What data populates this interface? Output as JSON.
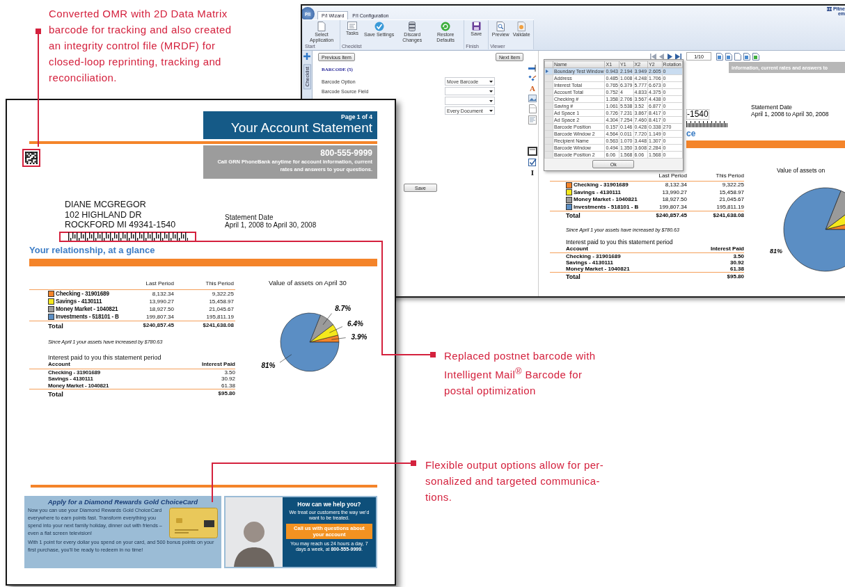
{
  "callouts": [
    {
      "lines": [
        "Converted OMR with 2D Data Matrix",
        "barcode for tracking  and also created",
        "an integrity control file (MRDF) for",
        "closed-loop reprinting, tracking and",
        "reconciliation."
      ]
    },
    {
      "lines": [
        "Replaced postnet barcode with",
        "Intelligent Mail$^{®}$ Barcode for",
        "postal optimization"
      ]
    },
    {
      "lines": [
        "Flexible output options allow for per-",
        "sonalized and targeted communica-",
        "tions."
      ]
    }
  ],
  "app_window": {
    "logo": "P/I",
    "brand": [
      "Pitne",
      "em"
    ],
    "tabs": [
      {
        "label": "P/I Wizard",
        "selected": true
      },
      {
        "label": "P/I Configuration",
        "selected": false
      }
    ],
    "ribbon": [
      {
        "group": "Start",
        "buttons": [
          {
            "label": "Select Application",
            "kind": "page"
          }
        ]
      },
      {
        "group": "Checklist",
        "buttons": [
          {
            "label": "Tasks",
            "kind": "tasks"
          },
          {
            "label": "Save Settings",
            "kind": "check"
          },
          {
            "label": "Discard Changes",
            "kind": "discard"
          },
          {
            "label": "Restore Defaults",
            "kind": "restore"
          }
        ]
      },
      {
        "group": "Finish",
        "buttons": [
          {
            "label": "Save",
            "kind": "save"
          }
        ]
      },
      {
        "group": "Viewer",
        "buttons": [
          {
            "label": "Preview",
            "kind": "preview"
          },
          {
            "label": "Validate",
            "kind": "validate"
          }
        ]
      }
    ],
    "side_tab": "Checklist",
    "prev_button": "Previous Item",
    "next_button": "Next Item",
    "section": "BARCODE (5)",
    "form_rows": [
      {
        "label": "Barcode Option",
        "value": "Move Barcode"
      },
      {
        "label": "Barcode Source Field"
      },
      {},
      {
        "value": "Every Document"
      }
    ],
    "save_button": "Save",
    "tools": [
      {
        "kind": "line"
      },
      {
        "kind": "shapes"
      },
      {
        "kind": "text",
        "glyph": "A"
      },
      {
        "kind": "image"
      },
      {
        "kind": "page"
      },
      {
        "kind": "layout"
      },
      {
        "kind": "frame"
      },
      {
        "kind": "check"
      },
      {
        "kind": "text",
        "glyph": "I"
      }
    ],
    "pager": "1/10",
    "grid": {
      "columns": [
        "Name",
        "X1",
        "Y1",
        "X2",
        "Y2",
        "Rotation"
      ],
      "rows": [
        {
          "cells": [
            "Boundary Test Window",
            "0.943",
            "2.194",
            "3.949",
            "2.605",
            "0"
          ],
          "selected": true
        },
        {
          "cells": [
            "Address",
            "0.485",
            "1.008",
            "4.248",
            "1.706",
            "0"
          ],
          "selected": false
        },
        {
          "cells": [
            "Interest Total",
            "0.765",
            "6.379",
            "5.777",
            "6.673",
            "0"
          ],
          "selected": false
        },
        {
          "cells": [
            "Account Total",
            "0.752",
            "4",
            "4.833",
            "4.375",
            "0"
          ],
          "selected": false
        },
        {
          "cells": [
            "Checking #",
            "1.358",
            "2.706",
            "3.567",
            "4.438",
            "0"
          ],
          "selected": false
        },
        {
          "cells": [
            "Saving #",
            "1.061",
            "5.538",
            "3.52",
            "6.877",
            "0"
          ],
          "selected": false
        },
        {
          "cells": [
            "Ad Space 1",
            "0.726",
            "7.231",
            "3.867",
            "8.417",
            "0"
          ],
          "selected": false
        },
        {
          "cells": [
            "Ad Space 2",
            "4.304",
            "7.254",
            "7.460",
            "8.417",
            "0"
          ],
          "selected": false
        },
        {
          "cells": [
            "Barcode Position",
            "0.157",
            "0.146",
            "0.428",
            "0.338",
            "270"
          ],
          "selected": false
        },
        {
          "cells": [
            "Barcode Window 2",
            "4.564",
            "0.011",
            "7.720",
            "1.149",
            "0"
          ],
          "selected": false
        },
        {
          "cells": [
            "Recipient Name",
            "0.563",
            "1.070",
            "3.448",
            "1.307",
            "0"
          ],
          "selected": false
        },
        {
          "cells": [
            "Barcode Window",
            "0.494",
            "1.350",
            "3.608",
            "2.284",
            "0"
          ],
          "selected": false
        },
        {
          "cells": [
            "Barcode Position 2",
            "6.06",
            "1.568",
            "6.06",
            "1.568",
            "0"
          ],
          "selected": false
        }
      ],
      "ok_button": "Ok"
    },
    "preview": {
      "banner": "information, current rates and answers to",
      "address_tail": "-1540",
      "date_label": "Statement Date",
      "date_range": "April 1, 2008 to April 30, 2008",
      "heading_tail": "ce",
      "columns": [
        "Last Period",
        "This Period"
      ],
      "chart_title": "Value of assets on",
      "accounts": [
        {
          "name": "Checking - 31901689",
          "last": "8,132.34",
          "this": "9,322.25",
          "color": "#f4842a"
        },
        {
          "name": "Savings - 4130111",
          "last": "13,990.27",
          "this": "15,458.97",
          "color": "#f5e81c"
        },
        {
          "name": "Money Market - 1040821",
          "last": "18,927.50",
          "this": "21,045.67",
          "color": "#9a9a9a"
        },
        {
          "name": "Investments - 518101 - B",
          "last": "199,807.34",
          "this": "195,811.19",
          "color": "#5b8ec4"
        }
      ],
      "total": {
        "label": "Total",
        "last": "$240,857.45",
        "this": "$241,638.08"
      },
      "note": "Since April 1 your assets have increased by $780.63",
      "interest_title": "Interest paid to you this statement period",
      "interest_columns": [
        "Account",
        "Interest Paid"
      ],
      "interest_rows": [
        {
          "name": "Checking - 31901689",
          "value": "3.50"
        },
        {
          "name": "Savings - 4130111",
          "value": "30.92"
        },
        {
          "name": "Money Market - 1040821",
          "value": "61.38"
        }
      ],
      "interest_total": {
        "label": "Total",
        "value": "$95.80"
      },
      "pie_label": "81%"
    }
  },
  "statement": {
    "page": "Page 1 of 4",
    "title": "Your Account Statement",
    "phone": "800-555-9999",
    "phone_note": "Call GRN PhoneBank anytime for account information, current rates and answers to your questions.",
    "address": [
      "DIANE MCGREGOR",
      "102 HIGHLAND DR",
      "ROCKFORD MI 49341-1540"
    ],
    "date_label": "Statement Date",
    "date_range": "April 1, 2008 to April 30, 2008",
    "heading": "Your relationship, at a glance",
    "columns": [
      "Last Period",
      "This Period"
    ],
    "accounts": [
      {
        "name": "Checking - 31901689",
        "last": "8,132.34",
        "this": "9,322.25",
        "color": "#f4842a"
      },
      {
        "name": "Savings - 4130111",
        "last": "13,990.27",
        "this": "15,458.97",
        "color": "#f5e81c"
      },
      {
        "name": "Money Market - 1040821",
        "last": "18,927.50",
        "this": "21,045.67",
        "color": "#9a9a9a"
      },
      {
        "name": "Investments - 518101 - B",
        "last": "199,807.34",
        "this": "195,811.19",
        "color": "#5b8ec4"
      }
    ],
    "total": {
      "label": "Total",
      "last": "$240,857.45",
      "this": "$241,638.08"
    },
    "note": "Since April 1 your assets have increased by $780.63",
    "interest_title": "Interest paid to you this statement period",
    "interest_columns": [
      "Account",
      "Interest Paid"
    ],
    "interest_rows": [
      {
        "name": "Checking - 31901689",
        "value": "3.50"
      },
      {
        "name": "Savings - 4130111",
        "value": "30.92"
      },
      {
        "name": "Money Market - 1040821",
        "value": "61.38"
      }
    ],
    "interest_total": {
      "label": "Total",
      "value": "$95.80"
    },
    "chart_data": {
      "type": "pie",
      "title": "Value of assets on April 30",
      "values": [
        3.9,
        6.4,
        8.7,
        81
      ],
      "value_labels": [
        "3.9%",
        "6.4%",
        "8.7%",
        "81%"
      ]
    },
    "ads": {
      "card": {
        "title": "Apply for a Diamond Rewards Gold ChoiceCard",
        "body": "Now you can use your Diamond Rewards Gold ChoiceCard everywhere to earn points fast. Transform everything you spend into your next family holiday, dinner out with friends – even a flat screen television!",
        "body2": "With 1 point for every dollar you spend on your card, and 500 bonus points on your first purchase, you'll be ready to redeem in no time!"
      },
      "help": {
        "title": "How can we help you?",
        "text": "We treat our customers the way we'd want to be treated.",
        "button": "Call us with questions about your account",
        "footer": "You may reach us 24 hours a day, 7 days a week, at **800-555-9999**."
      }
    }
  }
}
